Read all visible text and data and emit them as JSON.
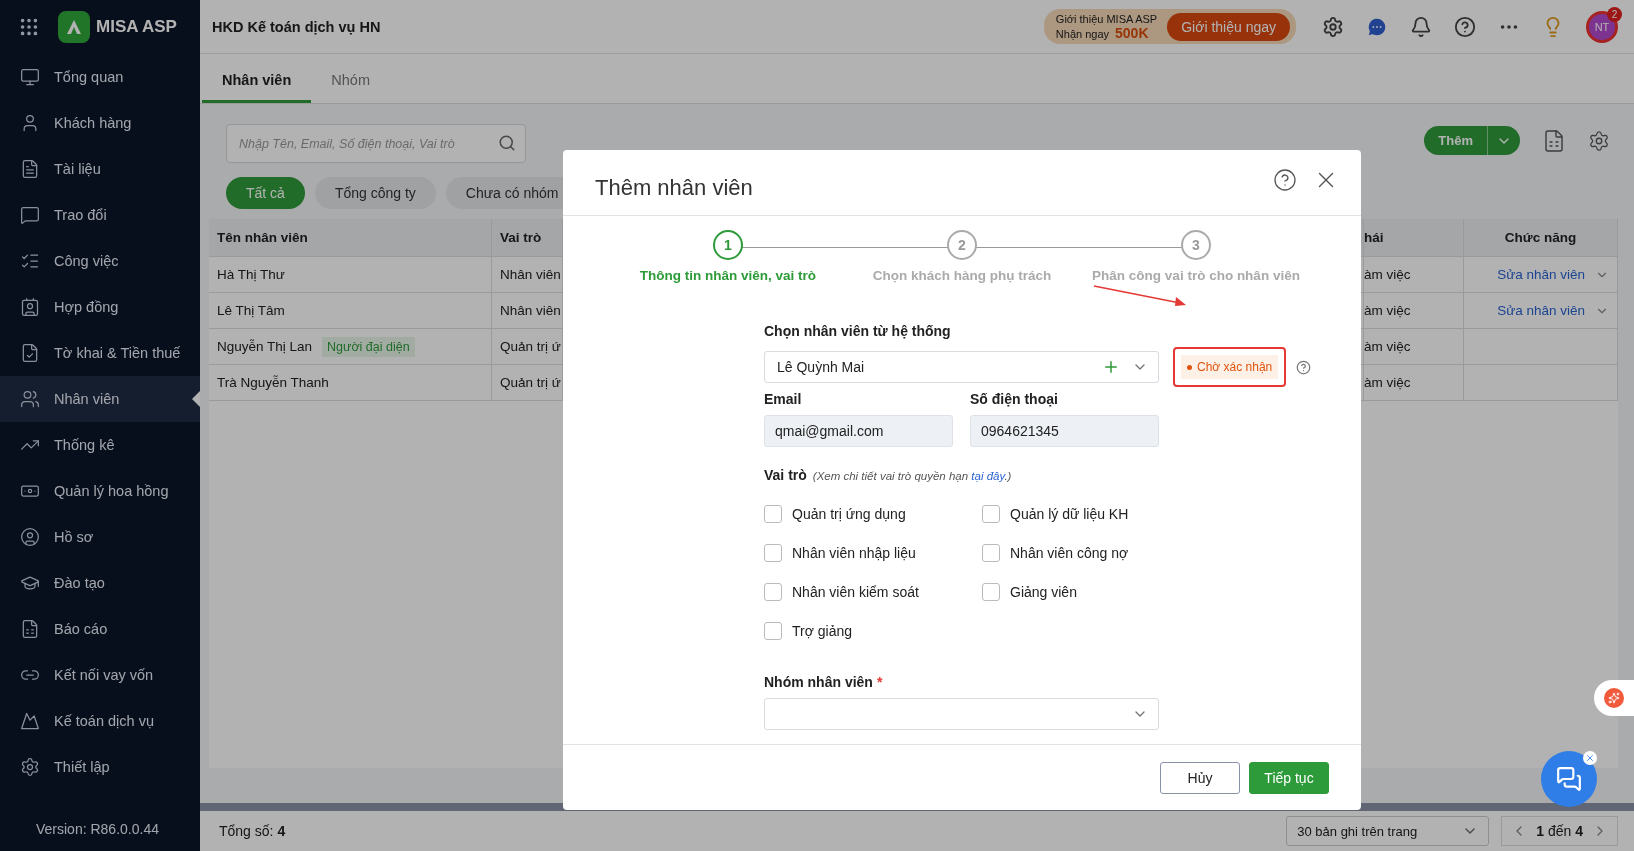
{
  "app": {
    "logo": "MISA ASP",
    "company": "HKD Kế toán dịch vụ HN"
  },
  "promo": {
    "line1": "Giới thiệu MISA ASP",
    "line2": "Nhận ngay",
    "amount": "500K",
    "button": "Giới thiệu ngay"
  },
  "avatar": {
    "initials": "NT",
    "badge": "2"
  },
  "sidebar": {
    "items": [
      {
        "label": "Tổng quan",
        "selected": false
      },
      {
        "label": "Khách hàng",
        "selected": false
      },
      {
        "label": "Tài liệu",
        "selected": false
      },
      {
        "label": "Trao đổi",
        "selected": false
      },
      {
        "label": "Công việc",
        "selected": false
      },
      {
        "label": "Hợp đồng",
        "selected": false
      },
      {
        "label": "Tờ khai & Tiền thuế",
        "selected": false
      },
      {
        "label": "Nhân viên",
        "selected": true
      },
      {
        "label": "Thống kê",
        "selected": false
      },
      {
        "label": "Quản lý hoa hồng",
        "selected": false
      },
      {
        "label": "Hồ sơ",
        "selected": false
      },
      {
        "label": "Đào tạo",
        "selected": false
      },
      {
        "label": "Báo cáo",
        "selected": false
      },
      {
        "label": "Kết nối vay vốn",
        "selected": false
      },
      {
        "label": "Kế toán dịch vụ",
        "selected": false
      },
      {
        "label": "Thiết lập",
        "selected": false
      }
    ],
    "version": "Version: R86.0.0.44"
  },
  "tabs": [
    {
      "label": "Nhân viên",
      "selected": true
    },
    {
      "label": "Nhóm",
      "selected": false
    }
  ],
  "search": {
    "placeholder": "Nhập Tên, Email, Số điện thoại, Vai trò"
  },
  "filters": [
    {
      "label": "Tất cả",
      "selected": true
    },
    {
      "label": "Tổng công ty",
      "selected": false
    },
    {
      "label": "Chưa có nhóm",
      "selected": false
    }
  ],
  "add_button": "Thêm",
  "table": {
    "columns": [
      "Tên nhân viên",
      "Vai trò",
      "hái",
      "Chức năng"
    ],
    "rows": [
      {
        "name": "Hà Thị Thư",
        "role": "Nhân viên",
        "status": "àm việc",
        "action": "Sửa nhân viên"
      },
      {
        "name": "Lê Thị Tâm",
        "role": "Nhân viên",
        "status": "àm việc",
        "action": "Sửa nhân viên"
      },
      {
        "name": "Nguyễn Thị Lan",
        "badge": "Người đại diện",
        "role": "Quản trị ứ",
        "status": "àm việc"
      },
      {
        "name": "Trà Nguyễn Thanh",
        "role": "Quản trị ứ",
        "status": "àm việc"
      }
    ]
  },
  "footer": {
    "total": "Tổng số: **4**",
    "page_size": "30 bản ghi trên trang",
    "range": "**1** đến **4**"
  },
  "dialog": {
    "title": "Thêm nhân viên",
    "steps": [
      {
        "number": "1",
        "label": "Thông tin nhân viên, vai trò",
        "selected": true
      },
      {
        "number": "2",
        "label": "Chọn khách hàng phụ trách",
        "selected": false
      },
      {
        "number": "3",
        "label": "Phân công vai trò cho nhân viên",
        "selected": false
      }
    ],
    "employee": {
      "label": "Chọn nhân viên từ hệ thống",
      "value": "Lê Quỳnh Mai",
      "status": "Chờ xác nhận"
    },
    "email": {
      "label": "Email",
      "value": "qmai@gmail.com"
    },
    "phone": {
      "label": "Số điện thoại",
      "value": "0964621345"
    },
    "roles_label": "Vai trò",
    "roles_note": {
      "text": "(Xem chi tiết vai trò quyền hạn",
      "link": "tại đây",
      "end": ".)"
    },
    "roles": [
      {
        "label": "Quản trị ứng dụng",
        "checked": false
      },
      {
        "label": "Quản lý dữ liệu KH",
        "checked": false
      },
      {
        "label": "Nhân viên nhập liệu",
        "checked": false
      },
      {
        "label": "Nhân viên công nợ",
        "checked": false
      },
      {
        "label": "Nhân viên kiểm soát",
        "checked": false
      },
      {
        "label": "Giảng viên",
        "checked": false
      },
      {
        "label": "Trợ giảng",
        "checked": false
      }
    ],
    "group": {
      "label": "Nhóm nhân viên",
      "required_mark": "*"
    },
    "buttons": [
      {
        "label": "Hủy",
        "kind": "secondary"
      },
      {
        "label": "Tiếp tục",
        "kind": "primary"
      }
    ]
  }
}
